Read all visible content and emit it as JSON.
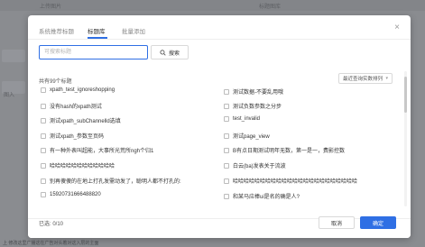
{
  "background": {
    "top_label": "上传图片",
    "top_right_label": "标题图库",
    "side_label": "图入"
  },
  "tabs": [
    {
      "label": "系统推荐标题"
    },
    {
      "label": "标题库"
    },
    {
      "label": "批量添加"
    }
  ],
  "search": {
    "placeholder": "可搜索标题",
    "button_label": "搜索",
    "icon": "search-icon"
  },
  "list": {
    "count_label": "共有99个标题",
    "sort_label": "最近查询实数排列",
    "left_items": [
      "xpath_test_ignoreshopping",
      "没有hash的xpath测试",
      "测试xpath_subChannelld选填",
      "测试xpath_参数至页码",
      "有一种外表叫超能，大事所光荒所ngh个归1",
      "哈哈哈哈哈哈哈哈哈哈哈哈",
      "别再傻傻的在地上打孔发需动发了，聪明人都不打孔的:",
      "15920731666488820"
    ],
    "right_items": [
      "测试数据-不要乱用哦",
      "测试负数参数之分步",
      "test_invalid",
      "测试page_view",
      "B有点日期测试明年无数，第一是一，费影控数",
      "白云(ba)发表关于流波",
      "哈哈哈哈哈哈哈哈哈哈哈哈哈哈哈哈哈哈哈哈哈哈哈",
      "和某马应棒ui是名的确是人?"
    ]
  },
  "footer": {
    "selected_label": "已选: 0/10",
    "cancel_label": "取消",
    "confirm_label": "确定"
  },
  "bottom_note": "上 修改这里广播这在广告对头着对这入层的主面"
}
